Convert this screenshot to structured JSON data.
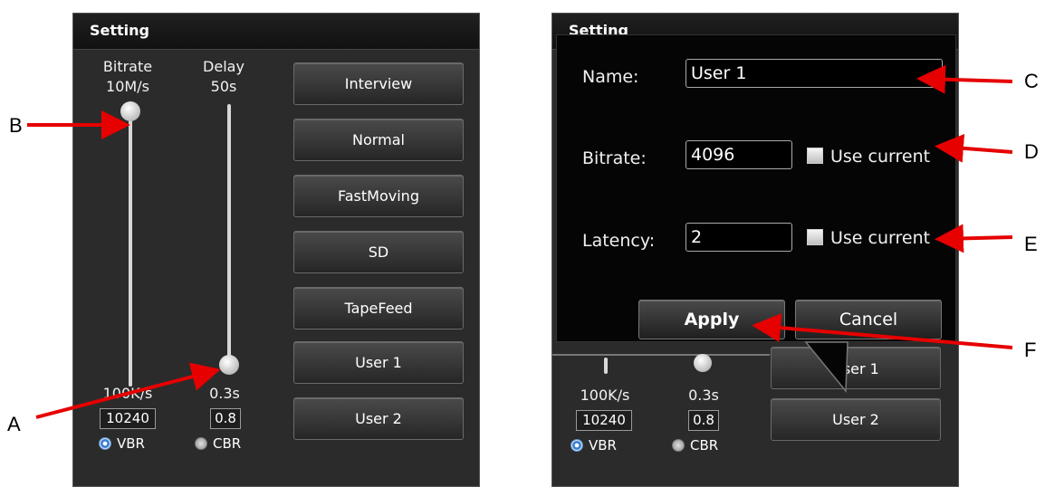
{
  "left_panel": {
    "title": "Setting",
    "bitrate": {
      "label": "Bitrate",
      "max": "10M/s",
      "min": "100K/s",
      "value": "10240"
    },
    "delay": {
      "label": "Delay",
      "max": "50s",
      "min": "0.3s",
      "value": "0.8"
    },
    "mode_options": [
      "VBR",
      "CBR"
    ],
    "selected_mode": "VBR",
    "presets": [
      "Interview",
      "Normal",
      "FastMoving",
      "SD",
      "TapeFeed",
      "User 1",
      "User 2"
    ]
  },
  "right_panel": {
    "title": "Setting",
    "bitrate_min": "100K/s",
    "bitrate_value": "10240",
    "delay_min": "0.3s",
    "delay_value": "0.8",
    "mode_options": [
      "VBR",
      "CBR"
    ],
    "partial_preset": "User 1",
    "preset_user2": "User 2"
  },
  "dialog": {
    "name_label": "Name:",
    "name_value": "User 1",
    "bitrate_label": "Bitrate:",
    "bitrate_value": "4096",
    "latency_label": "Latency:",
    "latency_value": "2",
    "use_current_label": "Use current",
    "apply_label": "Apply",
    "cancel_label": "Cancel"
  },
  "annotations": {
    "labels": [
      "A",
      "B",
      "C",
      "D",
      "E",
      "F"
    ],
    "arrow_color": "#e60000"
  }
}
